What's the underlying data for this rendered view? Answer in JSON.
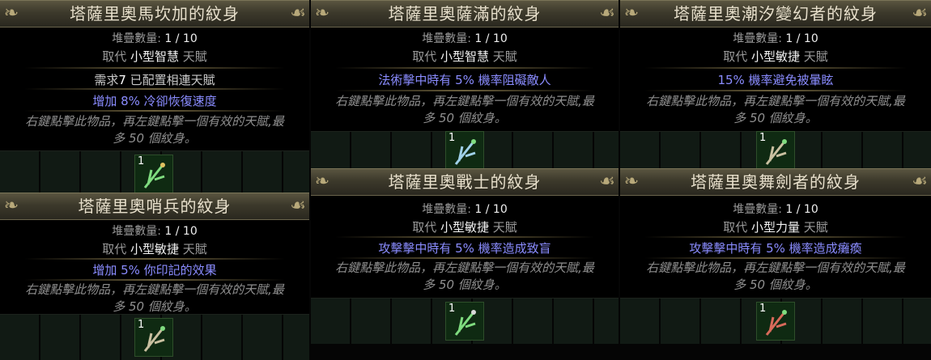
{
  "tooltips": {
    "ambush": {
      "title": "塔薩里奧馬坎加的紋身",
      "stack_label": "堆疊數量:",
      "stack_value": "1 / 10",
      "replaces_prefix": "取代",
      "replaces_node": "小型智慧",
      "replaces_suffix": "天賦",
      "requirement_prefix": "需求",
      "requirement_number": "7",
      "requirement_suffix": "已配置相連天賦",
      "modifier": "增加 8% 冷卻恢復速度",
      "flavour_line1": "右鍵點擊此物品，再左鍵點擊一個有效的天賦,最",
      "flavour_line2": "多 50 個紋身。"
    },
    "sentry": {
      "title": "塔薩里奧哨兵的紋身",
      "stack_label": "堆疊數量:",
      "stack_value": "1 / 10",
      "replaces_prefix": "取代",
      "replaces_node": "小型敏捷",
      "replaces_suffix": "天賦",
      "modifier": "增加 5% 你印記的效果",
      "flavour_line1": "右鍵點擊此物品，再左鍵點擊一個有效的天賦,最",
      "flavour_line2": "多 50 個紋身。"
    },
    "shaman": {
      "title": "塔薩里奧薩滿的紋身",
      "stack_label": "堆疊數量:",
      "stack_value": "1 / 10",
      "replaces_prefix": "取代",
      "replaces_node": "小型智慧",
      "replaces_suffix": "天賦",
      "modifier": "法術擊中時有 5% 機率阻礙敵人",
      "flavour_line1": "右鍵點擊此物品，再左鍵點擊一個有效的天賦,最",
      "flavour_line2": "多 50 個紋身。"
    },
    "warrior": {
      "title": "塔薩里奧戰士的紋身",
      "stack_label": "堆疊數量:",
      "stack_value": "1 / 10",
      "replaces_prefix": "取代",
      "replaces_node": "小型敏捷",
      "replaces_suffix": "天賦",
      "modifier": "攻擊擊中時有 5% 機率造成致盲",
      "flavour_line1": "右鍵點擊此物品，再左鍵點擊一個有效的天賦,最",
      "flavour_line2": "多 50 個紋身。"
    },
    "tidechanger": {
      "title": "塔薩里奧潮汐變幻者的紋身",
      "stack_label": "堆疊數量:",
      "stack_value": "1 / 10",
      "replaces_prefix": "取代",
      "replaces_node": "小型敏捷",
      "replaces_suffix": "天賦",
      "modifier": "15% 機率避免被暈眩",
      "flavour_line1": "右鍵點擊此物品，再左鍵點擊一個有效的天賦,最",
      "flavour_line2": "多 50 個紋身。"
    },
    "bladedancer": {
      "title": "塔薩里奧舞劍者的紋身",
      "stack_label": "堆疊數量:",
      "stack_value": "1 / 10",
      "replaces_prefix": "取代",
      "replaces_node": "小型力量",
      "replaces_suffix": "天賦",
      "modifier": "攻擊擊中時有 5% 機率造成癱瘓",
      "flavour_line1": "右鍵點擊此物品，再左鍵點擊一個有效的天賦,最",
      "flavour_line2": "多 50 個紋身。"
    }
  },
  "inventory": {
    "ambush": {
      "count": "1",
      "icon": "tattoo-icon"
    },
    "sentry": {
      "count": "1",
      "icon": "tattoo-icon"
    },
    "shaman": {
      "count": "1",
      "icon": "tattoo-icon"
    },
    "warrior": {
      "count": "1",
      "icon": "tattoo-icon"
    },
    "tidechanger": {
      "count": "1",
      "icon": "tattoo-icon"
    },
    "bladedancer": {
      "count": "1",
      "icon": "tattoo-icon"
    }
  },
  "colors": {
    "header_gold": "#e8e0cc",
    "magic_blue": "#8a8cff",
    "flavour_gray": "#8f8f8f",
    "item_bg_green": "#0f2a12"
  }
}
